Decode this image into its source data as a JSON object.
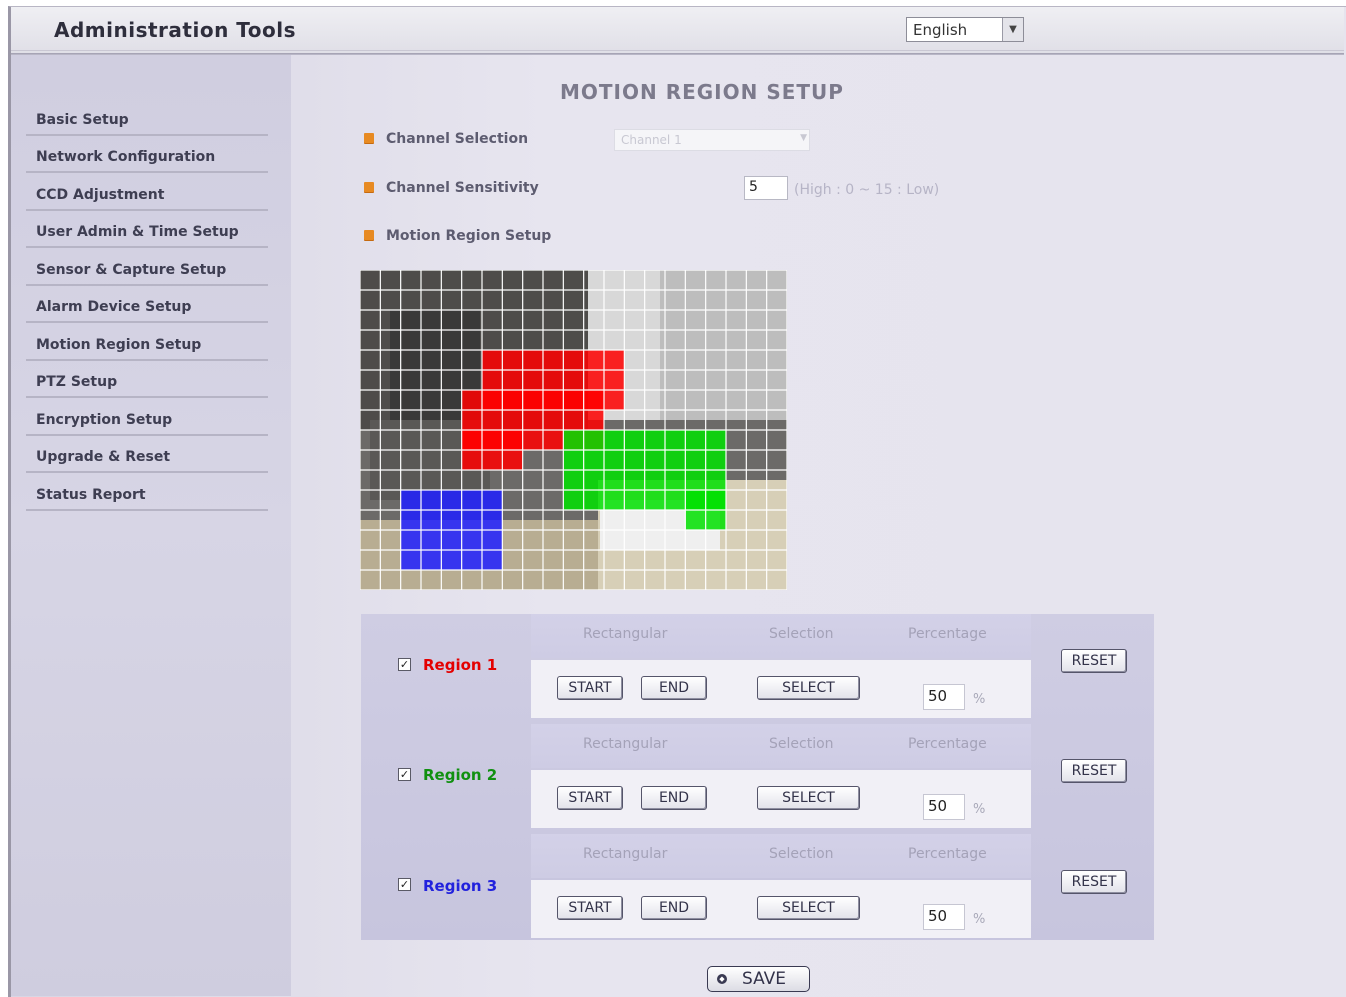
{
  "header": {
    "title": "Administration Tools",
    "language": {
      "selected": "English"
    }
  },
  "sidebar": {
    "items": [
      {
        "label": "Basic Setup"
      },
      {
        "label": "Network Configuration"
      },
      {
        "label": "CCD Adjustment"
      },
      {
        "label": "User Admin & Time Setup"
      },
      {
        "label": "Sensor & Capture Setup"
      },
      {
        "label": "Alarm Device Setup"
      },
      {
        "label": "Motion Region Setup"
      },
      {
        "label": "PTZ Setup"
      },
      {
        "label": "Encryption Setup"
      },
      {
        "label": "Upgrade & Reset"
      },
      {
        "label": "Status Report"
      }
    ]
  },
  "main": {
    "title": "MOTION REGION SETUP",
    "channel_selection": {
      "label": "Channel Selection",
      "value": "Channel 1"
    },
    "channel_sensitivity": {
      "label": "Channel Sensitivity",
      "value": "5",
      "hint": "(High : 0 ~ 15 : Low)"
    },
    "motion_region_setup": {
      "label": "Motion Region Setup"
    },
    "region_colors": {
      "region1": "#ff0000",
      "region2": "#00e000",
      "region3": "#2020ff"
    },
    "regions": [
      {
        "name": "Region 1",
        "color": "#e40000",
        "checked": true,
        "headers": {
          "rectangular": "Rectangular",
          "selection": "Selection",
          "percentage": "Percentage"
        },
        "start_label": "START",
        "end_label": "END",
        "select_label": "SELECT",
        "percentage": "50",
        "unit": "%",
        "reset_label": "RESET"
      },
      {
        "name": "Region 2",
        "color": "#109010",
        "checked": true,
        "headers": {
          "rectangular": "Rectangular",
          "selection": "Selection",
          "percentage": "Percentage"
        },
        "start_label": "START",
        "end_label": "END",
        "select_label": "SELECT",
        "percentage": "50",
        "unit": "%",
        "reset_label": "RESET"
      },
      {
        "name": "Region 3",
        "color": "#2222dd",
        "checked": true,
        "headers": {
          "rectangular": "Rectangular",
          "selection": "Selection",
          "percentage": "Percentage"
        },
        "start_label": "START",
        "end_label": "END",
        "select_label": "SELECT",
        "percentage": "50",
        "unit": "%",
        "reset_label": "RESET"
      }
    ],
    "save_label": "SAVE"
  }
}
